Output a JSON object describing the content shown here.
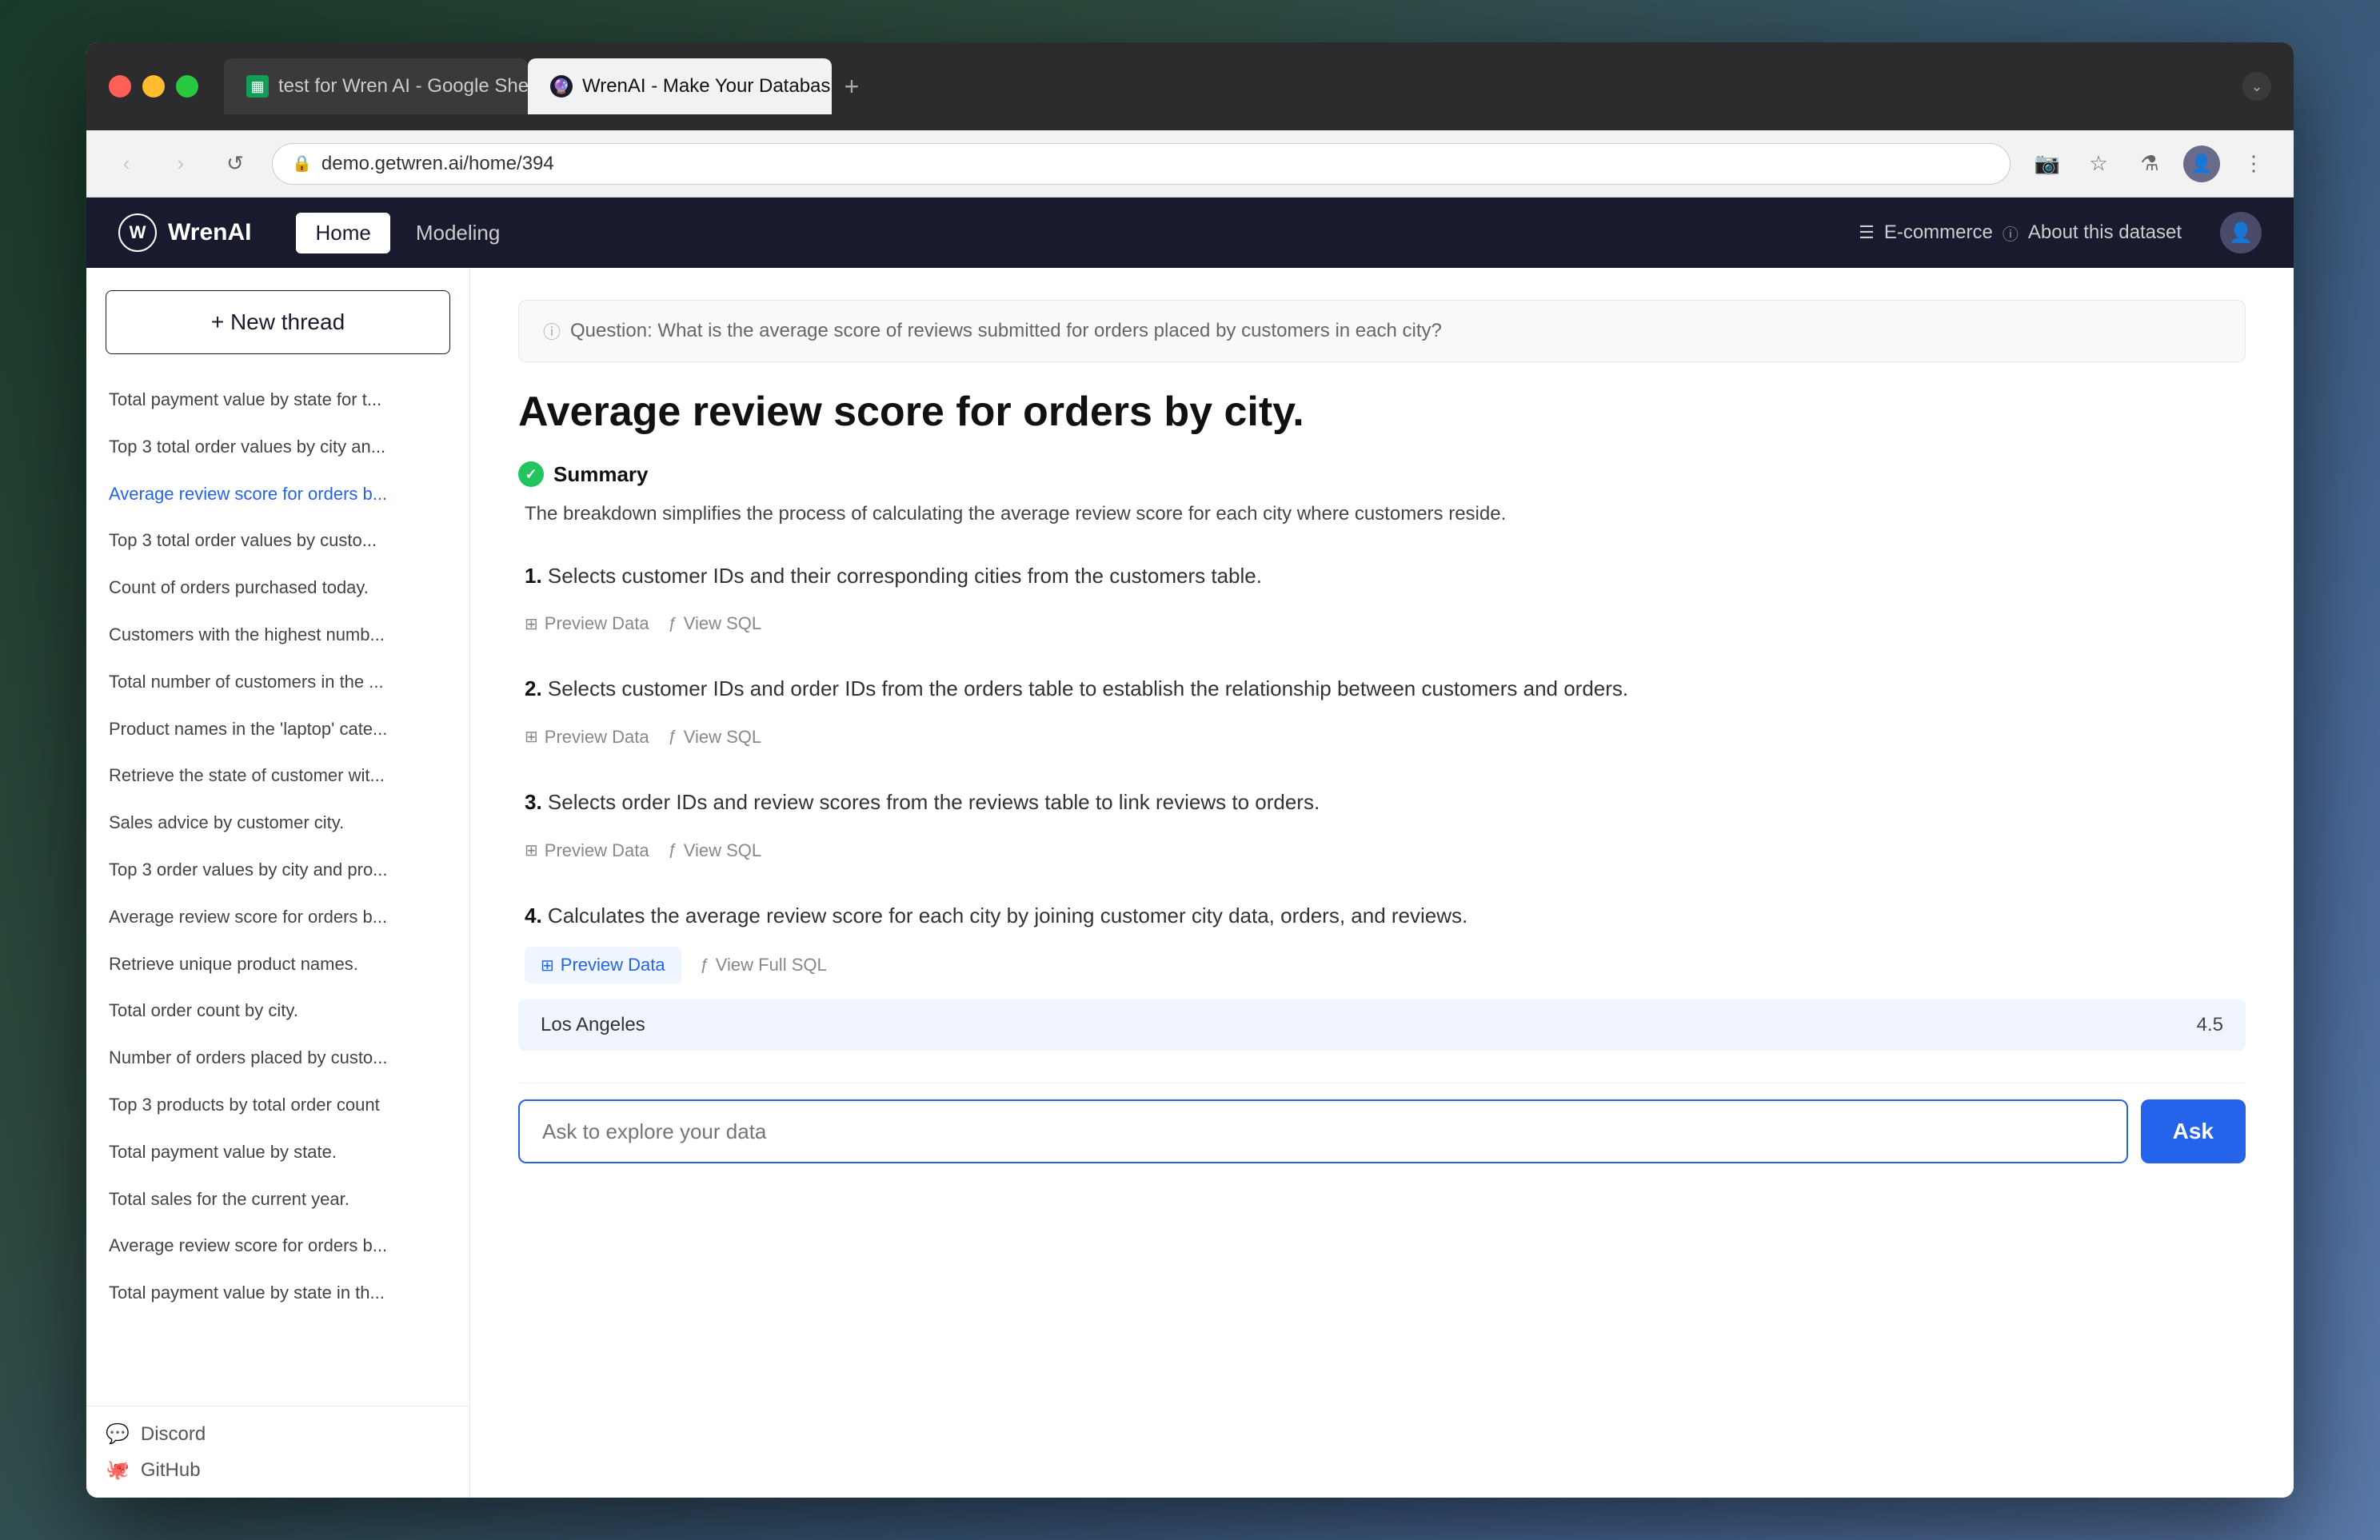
{
  "browser": {
    "tabs": [
      {
        "id": "tab1",
        "favicon_type": "sheets",
        "label": "test for Wren AI - Google She",
        "active": false
      },
      {
        "id": "tab2",
        "favicon_type": "wren",
        "label": "WrenAI - Make Your Databas...",
        "active": true
      }
    ],
    "url": "demo.getwren.ai/home/394",
    "new_tab_icon": "+"
  },
  "header": {
    "logo_icon": "🦅",
    "logo_text": "WrenAI",
    "nav": [
      {
        "id": "home",
        "label": "Home",
        "active": true
      },
      {
        "id": "modeling",
        "label": "Modeling",
        "active": false
      }
    ],
    "dataset_icon": "☰",
    "dataset_name": "E-commerce",
    "dataset_help": "About this dataset"
  },
  "sidebar": {
    "new_thread_label": "+ New thread",
    "threads": [
      {
        "id": "t1",
        "label": "Total payment value by state for t...",
        "active": false
      },
      {
        "id": "t2",
        "label": "Top 3 total order values by city an...",
        "active": false
      },
      {
        "id": "t3",
        "label": "Average review score for orders b...",
        "active": true
      },
      {
        "id": "t4",
        "label": "Top 3 total order values by custo...",
        "active": false
      },
      {
        "id": "t5",
        "label": "Count of orders purchased today.",
        "active": false
      },
      {
        "id": "t6",
        "label": "Customers with the highest numb...",
        "active": false
      },
      {
        "id": "t7",
        "label": "Total number of customers in the ...",
        "active": false
      },
      {
        "id": "t8",
        "label": "Product names in the 'laptop' cate...",
        "active": false
      },
      {
        "id": "t9",
        "label": "Retrieve the state of customer wit...",
        "active": false
      },
      {
        "id": "t10",
        "label": "Sales advice by customer city.",
        "active": false
      },
      {
        "id": "t11",
        "label": "Top 3 order values by city and pro...",
        "active": false
      },
      {
        "id": "t12",
        "label": "Average review score for orders b...",
        "active": false
      },
      {
        "id": "t13",
        "label": "Retrieve unique product names.",
        "active": false
      },
      {
        "id": "t14",
        "label": "Total order count by city.",
        "active": false
      },
      {
        "id": "t15",
        "label": "Number of orders placed by custo...",
        "active": false
      },
      {
        "id": "t16",
        "label": "Top 3 products by total order count",
        "active": false
      },
      {
        "id": "t17",
        "label": "Total payment value by state.",
        "active": false
      },
      {
        "id": "t18",
        "label": "Total sales for the current year.",
        "active": false
      },
      {
        "id": "t19",
        "label": "Average review score for orders b...",
        "active": false
      },
      {
        "id": "t20",
        "label": "Total payment value by state in th...",
        "active": false
      }
    ],
    "footer": [
      {
        "id": "discord",
        "icon": "💬",
        "label": "Discord"
      },
      {
        "id": "github",
        "icon": "🐙",
        "label": "GitHub"
      }
    ]
  },
  "content": {
    "question": "Question: What is the average score of reviews submitted for orders placed by customers in each city?",
    "title": "Average review score for orders by city.",
    "summary_label": "Summary",
    "summary_text": "The breakdown simplifies the process of calculating the average review score for each city where customers reside.",
    "steps": [
      {
        "number": "1",
        "description": "Selects customer IDs and their corresponding cities from the customers table.",
        "actions": [
          {
            "id": "preview1",
            "label": "Preview Data",
            "active": false,
            "icon": "⊞"
          },
          {
            "id": "sql1",
            "label": "View SQL",
            "active": false,
            "icon": "ƒ"
          }
        ]
      },
      {
        "number": "2",
        "description": "Selects customer IDs and order IDs from the orders table to establish the relationship between customers and orders.",
        "actions": [
          {
            "id": "preview2",
            "label": "Preview Data",
            "active": false,
            "icon": "⊞"
          },
          {
            "id": "sql2",
            "label": "View SQL",
            "active": false,
            "icon": "ƒ"
          }
        ]
      },
      {
        "number": "3",
        "description": "Selects order IDs and review scores from the reviews table to link reviews to orders.",
        "actions": [
          {
            "id": "preview3",
            "label": "Preview Data",
            "active": false,
            "icon": "⊞"
          },
          {
            "id": "sql3",
            "label": "View SQL",
            "active": false,
            "icon": "ƒ"
          }
        ]
      },
      {
        "number": "4",
        "description": "Calculates the average review score for each city by joining customer city data, orders, and reviews.",
        "actions": [
          {
            "id": "preview4",
            "label": "Preview Data",
            "active": true,
            "icon": "⊞"
          },
          {
            "id": "sql4",
            "label": "View Full SQL",
            "active": false,
            "icon": "ƒ"
          }
        ]
      }
    ],
    "preview_data": {
      "city": "Los Angeles",
      "value": "4.5"
    },
    "ask_placeholder": "Ask to explore your data",
    "ask_button_label": "Ask"
  }
}
